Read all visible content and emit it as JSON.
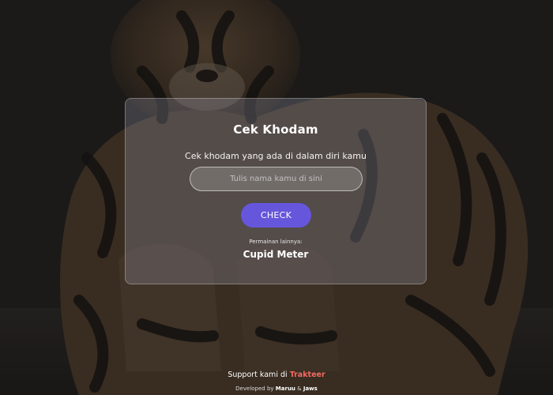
{
  "card": {
    "title": "Cek Khodam",
    "subtitle": "Cek khodam yang ada di dalam diri kamu",
    "input_placeholder": "Tulis nama kamu di sini",
    "input_value": "",
    "check_label": "CHECK",
    "other_games_label": "Permainan lainnya:",
    "other_game_link": "Cupid Meter"
  },
  "footer": {
    "support_prefix": "Support kami di",
    "support_link": "Trakteer",
    "developed_prefix": "Developed by",
    "developer_1": "Maruu",
    "developer_sep": "&",
    "developer_2": "Jaws"
  },
  "colors": {
    "button": "#6656dc",
    "trakteer": "#f26a62",
    "background": "#262422"
  }
}
